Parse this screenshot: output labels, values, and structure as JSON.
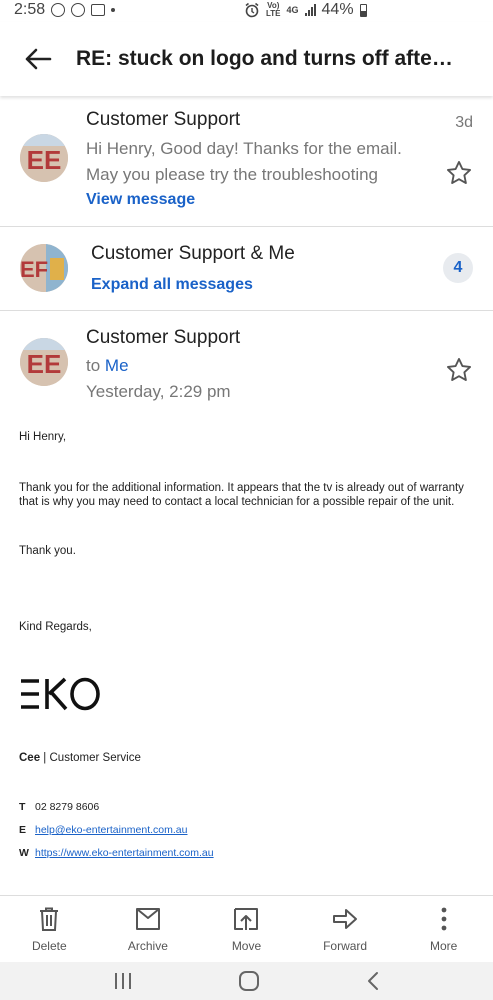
{
  "status_bar": {
    "time": "2:58",
    "network_top": "Vo)",
    "network_bottom": "LTE",
    "gen": "4G",
    "battery": "44%"
  },
  "header": {
    "title": "RE: stuck on logo and turns off after ..."
  },
  "messages": [
    {
      "sender": "Customer Support",
      "date": "3d",
      "snippet": "Hi Henry, Good day! Thanks for the email. May you please try the troubleshooting",
      "link": "View message"
    },
    {
      "sender": "Customer Support & Me",
      "link": "Expand all messages",
      "count": "4"
    }
  ],
  "expanded": {
    "sender": "Customer Support",
    "to_prefix": "to",
    "to": "Me",
    "date": "Yesterday, 2:29 pm",
    "greeting": "Hi Henry,",
    "paragraph": "Thank you for the additional information. It appears that the tv is already out of warranty that is why you may need to contact a local technician for a possible repair of the unit.",
    "thanks": "Thank you.",
    "regards": "Kind Regards,",
    "logo_text": "EKO",
    "sig_name": "Cee",
    "sig_role": " | Customer Service",
    "contacts": [
      {
        "label": "T",
        "value": "02 8279 8606"
      },
      {
        "label": "E",
        "value": "help@eko-entertainment.com.au"
      },
      {
        "label": "W",
        "value": "https://www.eko-entertainment.com.au"
      }
    ]
  },
  "toolbar": [
    {
      "label": "Delete",
      "icon": "trash-icon"
    },
    {
      "label": "Archive",
      "icon": "archive-icon"
    },
    {
      "label": "Move",
      "icon": "move-icon"
    },
    {
      "label": "Forward",
      "icon": "forward-icon"
    },
    {
      "label": "More",
      "icon": "more-vertical-icon"
    }
  ],
  "colors": {
    "link": "#1a62c8",
    "muted": "#777777",
    "badge_bg": "#e8ebef"
  }
}
